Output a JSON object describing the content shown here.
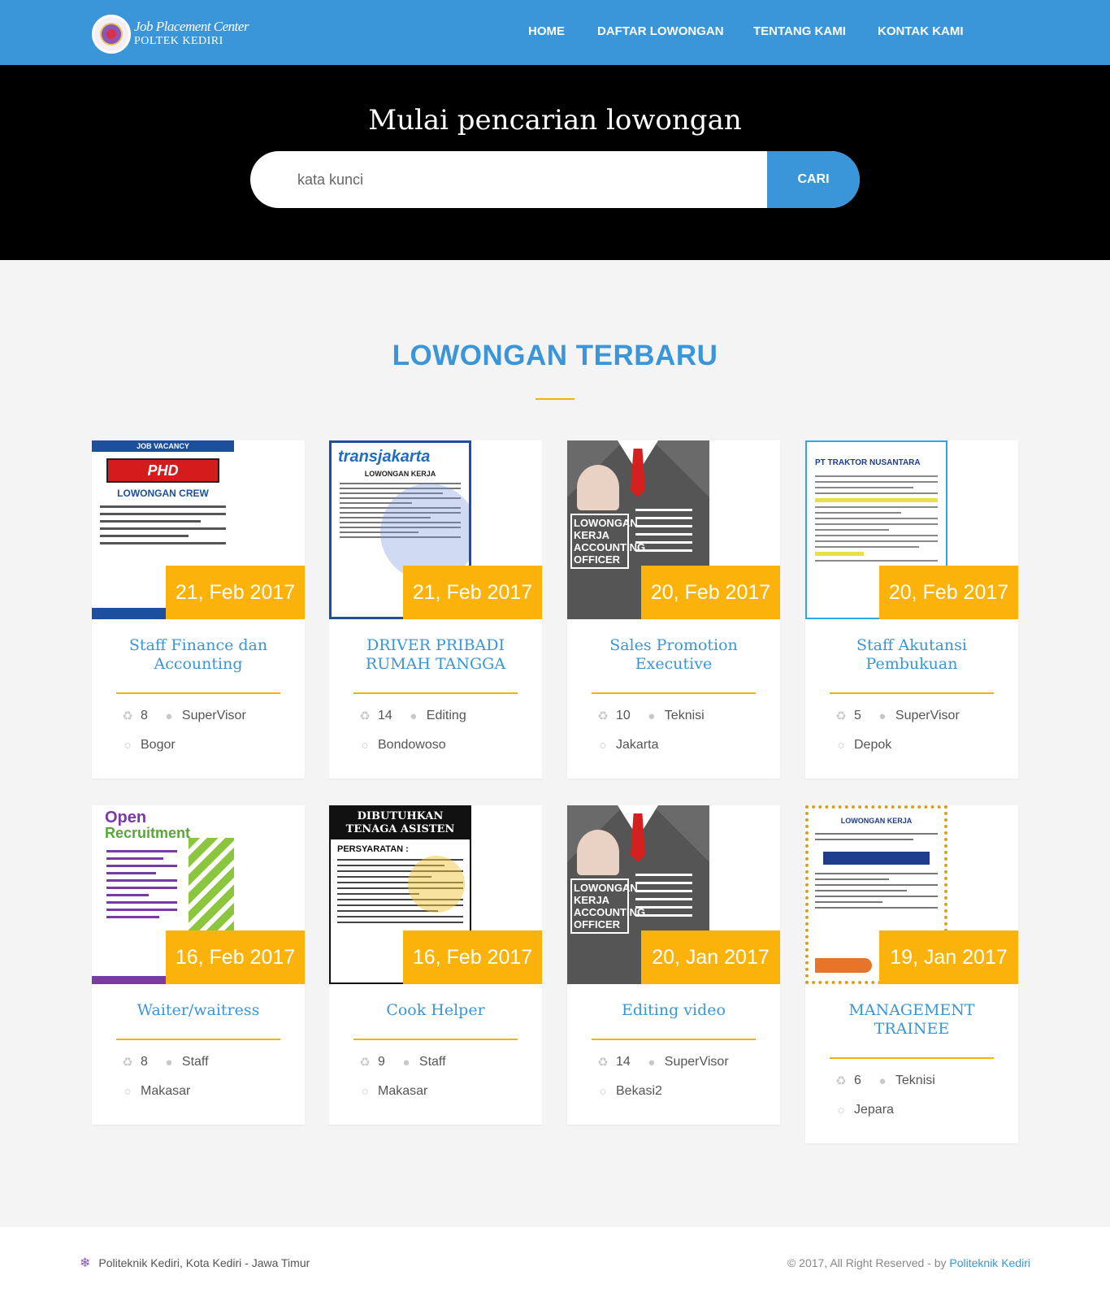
{
  "navbar": {
    "logo_line1": "Job Placement Center",
    "logo_line2": "POLTEK KEDIRI",
    "menu": [
      {
        "label": "HOME"
      },
      {
        "label": "DAFTAR LOWONGAN"
      },
      {
        "label": "TENTANG KAMI"
      },
      {
        "label": "KONTAK KAMI"
      }
    ]
  },
  "hero": {
    "title": "Mulai pencarian lowongan",
    "search_placeholder": "kata kunci",
    "search_button": "CARI"
  },
  "section": {
    "title": "LOWONGAN TERBARU"
  },
  "jobs": [
    {
      "date": "21, Feb 2017",
      "title": "Staff Finance dan Accounting",
      "quota": "8",
      "position": "SuperVisor",
      "location": "Bogor",
      "poster": "phd-pizza-hut-job-vacancy"
    },
    {
      "date": "21, Feb 2017",
      "title": "DRIVER PRIBADI RUMAH TANGGA",
      "quota": "14",
      "position": "Editing",
      "location": "Bondowoso",
      "poster": "transjakarta-lowongan-kerja"
    },
    {
      "date": "20, Feb 2017",
      "title": "Sales Promotion Executive",
      "quota": "10",
      "position": "Teknisi",
      "location": "Jakarta",
      "poster": "accounting-officer-suit"
    },
    {
      "date": "20, Feb 2017",
      "title": "Staff Akutansi Pembukuan",
      "quota": "5",
      "position": "SuperVisor",
      "location": "Depok",
      "poster": "traktor-nusantara-vacancy"
    },
    {
      "date": "16, Feb 2017",
      "title": "Waiter/waitress",
      "quota": "8",
      "position": "Staff",
      "location": "Makasar",
      "poster": "open-recruitment"
    },
    {
      "date": "16, Feb 2017",
      "title": "Cook Helper",
      "quota": "9",
      "position": "Staff",
      "location": "Makasar",
      "poster": "dibutuhkan-tenaga-asisten"
    },
    {
      "date": "20, Jan 2017",
      "title": "Editing video",
      "quota": "14",
      "position": "SuperVisor",
      "location": "Bekasi2",
      "poster": "accounting-officer-suit"
    },
    {
      "date": "19, Jan 2017",
      "title": "MANAGEMENT TRAINEE",
      "quota": "6",
      "position": "Teknisi",
      "location": "Jepara",
      "poster": "lowongan-kerja-guru"
    }
  ],
  "poster_text": {
    "job_vacancy": "JOB VACANCY",
    "phd": "PHD",
    "lowongan_crew": "LOWONGAN CREW",
    "transjakarta": "transjakarta",
    "lowongan_kerja": "LOWONGAN KERJA",
    "accounting_officer": "LOWONGAN KERJA ACCOUNTING OFFICER",
    "traktor": "PT TRAKTOR NUSANTARA",
    "open": "Open",
    "recruitment": "Recruitment",
    "dibutuhkan": "DIBUTUHKAN TENAGA ASISTEN",
    "persyaratan": "PERSYARATAN :"
  },
  "footer": {
    "address": "Politeknik Kediri, Kota Kediri - Jawa Timur",
    "copyright": "© 2017, All Right Reserved - by ",
    "copyright_link": "Politeknik Kediri"
  },
  "colors": {
    "primary": "#3a96d8",
    "accent": "#fbb20a",
    "hero_bg": "#000000"
  },
  "icons": {
    "quota": "people-icon",
    "position": "user-icon",
    "location": "user-icon",
    "footer": "snowflake-icon"
  }
}
